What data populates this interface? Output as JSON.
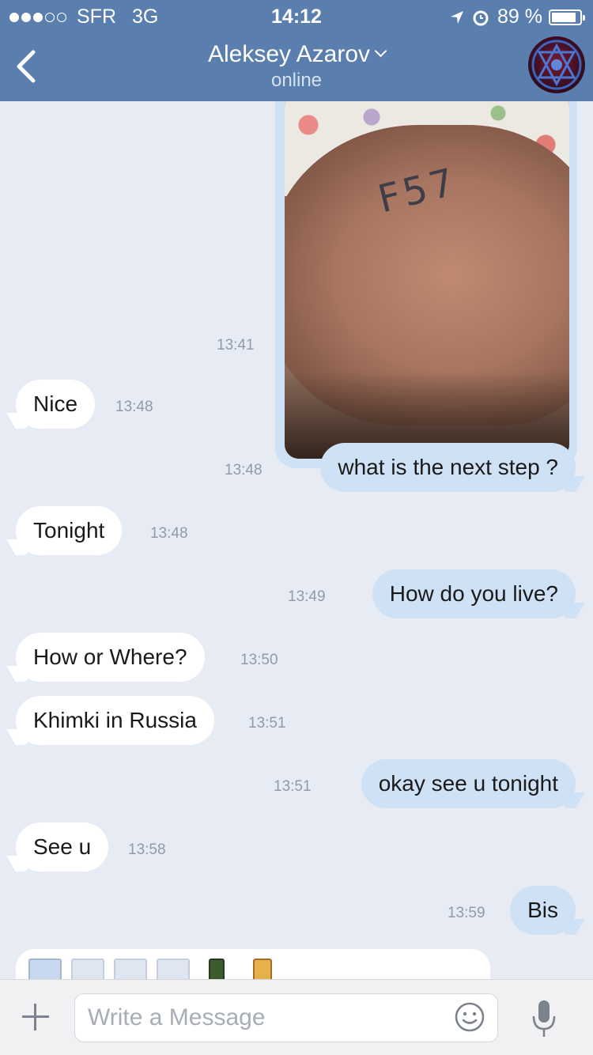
{
  "status_bar": {
    "carrier": "SFR",
    "network": "3G",
    "time": "14:12",
    "battery": "89 %",
    "battery_level": 0.89,
    "signal_bars": 3
  },
  "header": {
    "contact_name": "Aleksey Azarov",
    "status": "online",
    "icons": [
      "back-chevron-icon",
      "dropdown-chevron-icon",
      "avatar-image"
    ]
  },
  "colors": {
    "header": "#5a7fae",
    "chat_bg": "#e7ecf4",
    "outgoing_bubble": "#cfe1f5",
    "incoming_bubble": "#ffffff",
    "timestamp": "#8e9bab"
  },
  "photo_message": {
    "time": "13:41",
    "ink_text": "F57",
    "direction": "out"
  },
  "messages": [
    {
      "direction": "in",
      "text": "Nice",
      "time": "13:48"
    },
    {
      "direction": "out",
      "text": "what is the next step ?",
      "time": "13:48"
    },
    {
      "direction": "in",
      "text": "Tonight",
      "time": "13:48"
    },
    {
      "direction": "out",
      "text": "How do you live?",
      "time": "13:49"
    },
    {
      "direction": "in",
      "text": "How or Where?",
      "time": "13:50"
    },
    {
      "direction": "in",
      "text": "Khimki in Russia",
      "time": "13:51"
    },
    {
      "direction": "out",
      "text": "okay see u tonight",
      "time": "13:51"
    },
    {
      "direction": "in",
      "text": "See u",
      "time": "13:58"
    },
    {
      "direction": "out",
      "text": "Bis",
      "time": "13:59"
    }
  ],
  "input": {
    "placeholder": "Write a Message",
    "icons": [
      "plus-icon",
      "emoji-icon",
      "microphone-icon"
    ]
  }
}
